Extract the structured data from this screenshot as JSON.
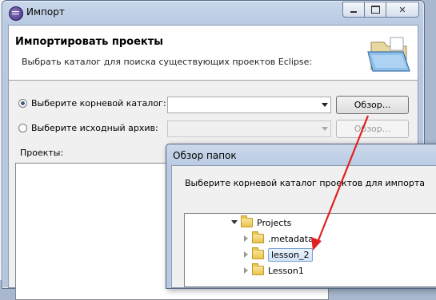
{
  "window": {
    "title": "Импорт",
    "heading": "Импортировать проекты",
    "description": "Выбрать каталог для поиска существующих проектов Eclipse:",
    "close_glyph": "✕"
  },
  "options": {
    "root_dir": {
      "label": "Выберите корневой каталог:",
      "value": "",
      "selected": true,
      "button": "Обзор..."
    },
    "archive": {
      "label": "Выберите исходный архив:",
      "value": "",
      "selected": false,
      "button": "Обзор..."
    }
  },
  "projects": {
    "label": "Проекты:",
    "items": []
  },
  "browse_dialog": {
    "title": "Обзор папок",
    "description": "Выберите корневой каталог проектов для импорта",
    "tree": [
      {
        "label": "Projects",
        "expanded": true,
        "selected": false
      },
      {
        "label": ".metadata",
        "expanded": false,
        "selected": false
      },
      {
        "label": "lesson_2",
        "expanded": false,
        "selected": true
      },
      {
        "label": "Lesson1",
        "expanded": false,
        "selected": false
      }
    ]
  },
  "colors": {
    "annotation_arrow": "#e02020",
    "selection": "#d1e2f7"
  },
  "icons": [
    "eclipse-app-icon",
    "open-folder-icon",
    "folder-icon"
  ]
}
